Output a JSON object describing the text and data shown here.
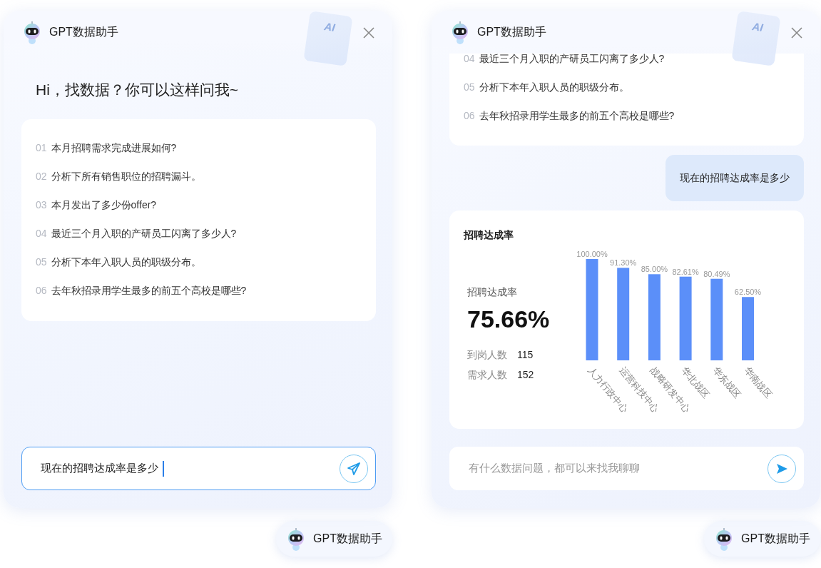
{
  "panels": [
    {
      "kind": "welcome",
      "header": {
        "title": "GPT数据助手",
        "art_text": "AI"
      },
      "greeting": "Hi，找数据？你可以这样问我~",
      "messages": [
        {
          "kind": "question_list",
          "clipped": false,
          "questions": [
            {
              "number": "01",
              "text": "本月招聘需求完成进展如何?"
            },
            {
              "number": "02",
              "text": "分析下所有销售职位的招聘漏斗。"
            },
            {
              "number": "03",
              "text": "本月发出了多少份offer?"
            },
            {
              "number": "04",
              "text": "最近三个月入职的产研员工闪离了多少人?"
            },
            {
              "number": "05",
              "text": "分析下本年入职人员的职级分布。"
            },
            {
              "number": "06",
              "text": "去年秋招录用学生最多的前五个高校是哪些?"
            }
          ]
        }
      ],
      "input": {
        "value": "现在的招聘达成率是多少",
        "focused": true
      },
      "launcher": {
        "label": "GPT数据助手"
      }
    },
    {
      "kind": "conversation",
      "header": {
        "title": "GPT数据助手",
        "art_text": "AI"
      },
      "messages": [
        {
          "kind": "question_list",
          "clipped": true,
          "questions": [
            {
              "number": "04",
              "text": "最近三个月入职的产研员工闪离了多少人?"
            },
            {
              "number": "05",
              "text": "分析下本年入职人员的职级分布。"
            },
            {
              "number": "06",
              "text": "去年秋招录用学生最多的前五个高校是哪些?"
            }
          ]
        },
        {
          "kind": "user",
          "text": "现在的招聘达成率是多少"
        },
        {
          "kind": "chart_card",
          "title": "招聘达成率",
          "metric_label": "招聘达成率",
          "metric_value": "75.66%",
          "stats": [
            {
              "label": "到岗人数",
              "value": "115"
            },
            {
              "label": "需求人数",
              "value": "152"
            }
          ],
          "chart_data": {
            "type": "bar",
            "categories": [
              "人力行政中心",
              "运营科技中心",
              "战略研发中心",
              "华北战区",
              "华东战区",
              "华南战区"
            ],
            "series": [
              {
                "color": "#5b8ff9",
                "values": [
                  100.0,
                  91.3,
                  85.0,
                  82.61,
                  80.49,
                  62.5
                ],
                "value_labels": [
                  "100.00%",
                  "91.30%",
                  "85.00%",
                  "82.61%",
                  "80.49%",
                  "62.50%"
                ]
              }
            ],
            "data_labels": true
          }
        }
      ],
      "input": {
        "placeholder": "有什么数据问题，都可以来找我聊聊",
        "focused": false
      },
      "launcher": {
        "label": "GPT数据助手"
      }
    }
  ]
}
